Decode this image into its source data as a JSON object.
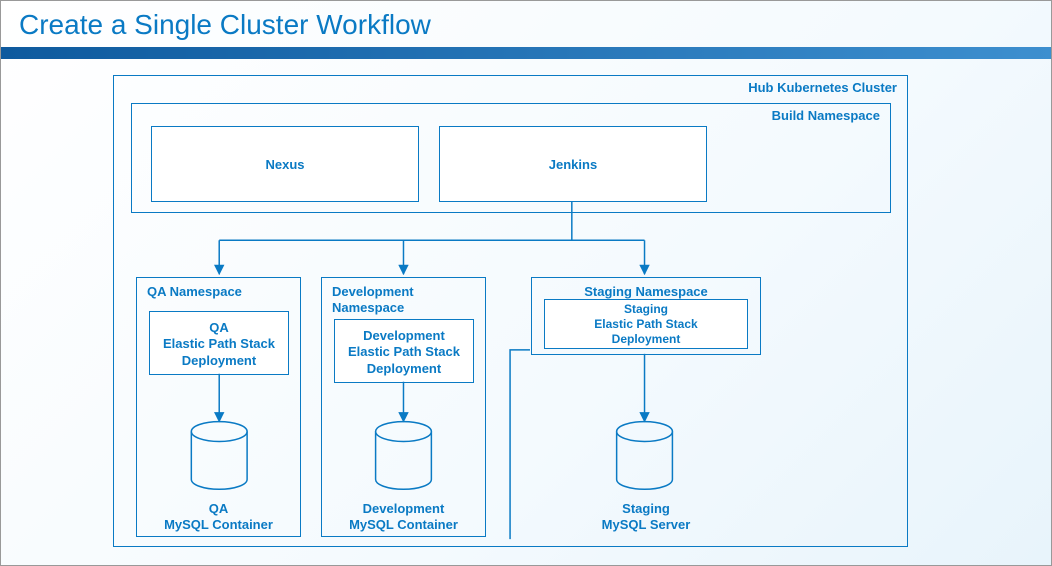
{
  "title": "Create a Single Cluster Workflow",
  "hub_cluster_label": "Hub Kubernetes Cluster",
  "build_namespace_label": "Build Namespace",
  "nexus": "Nexus",
  "jenkins": "Jenkins",
  "qa_namespace": "QA Namespace",
  "qa_deploy": "QA\nElastic Path Stack\nDeployment",
  "qa_db": "QA\nMySQL Container",
  "dev_namespace": "Development\nNamespace",
  "dev_deploy": "Development\nElastic Path Stack\nDeployment",
  "dev_db": "Development\nMySQL Container",
  "staging_namespace": "Staging Namespace",
  "staging_deploy": "Staging\nElastic Path Stack\nDeployment",
  "staging_db": "Staging\nMySQL Server",
  "colors": {
    "stroke": "#0a7ac4"
  }
}
